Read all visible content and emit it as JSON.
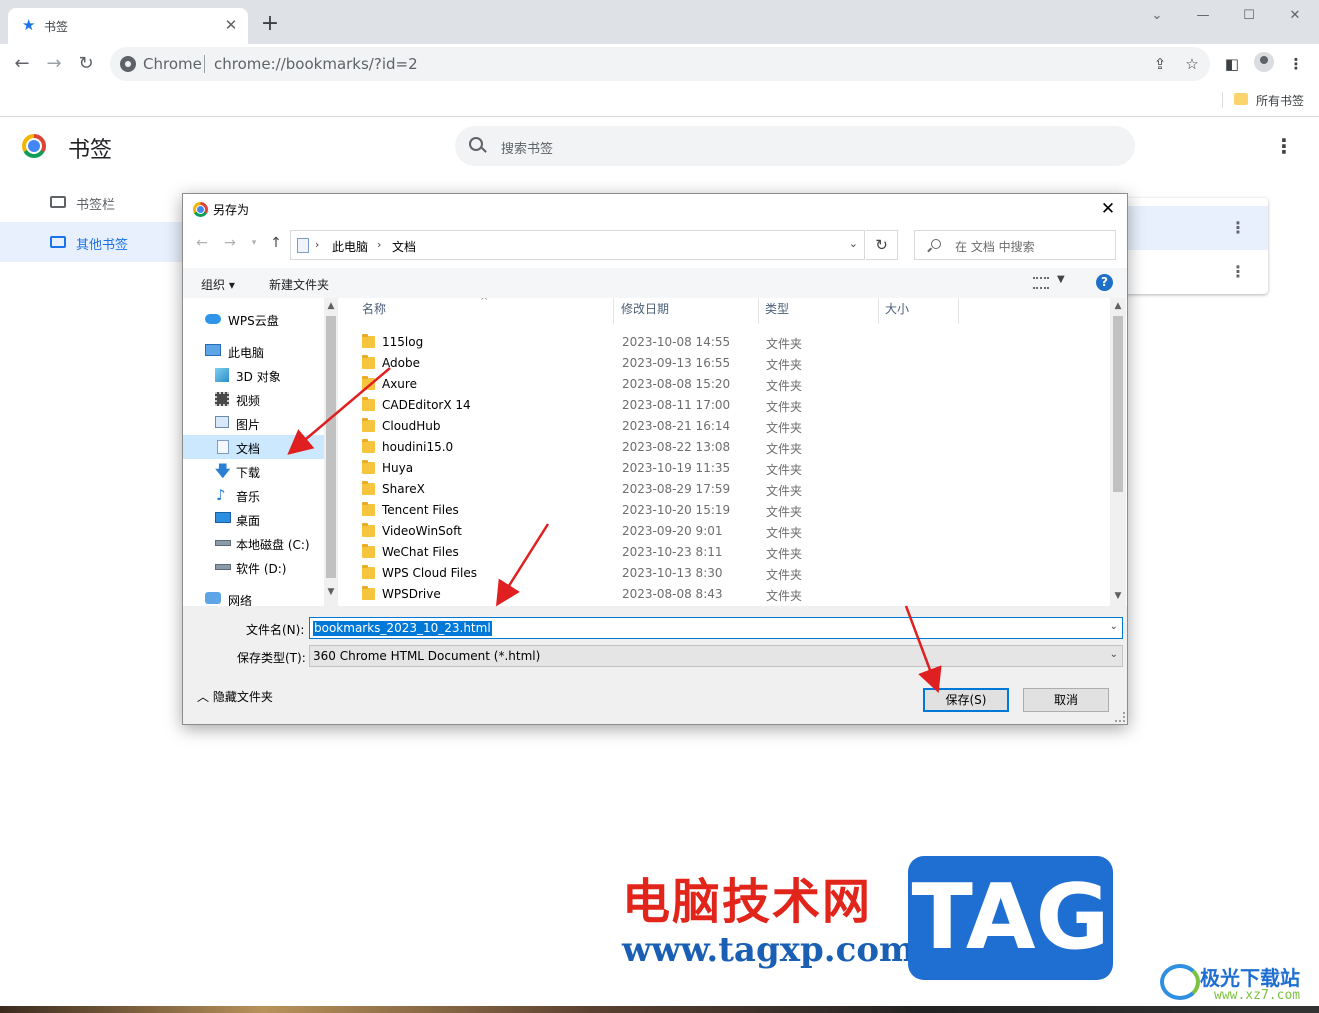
{
  "browser": {
    "tab_title": "书签",
    "omnibox_site": "Chrome",
    "omnibox_url": "chrome://bookmarks/?id=2",
    "bookmarks_bar_item": "所有书签"
  },
  "page": {
    "title": "书签",
    "search_placeholder": "搜索书签",
    "nav": [
      {
        "label": "书签栏",
        "active": false
      },
      {
        "label": "其他书签",
        "active": true
      }
    ]
  },
  "dialog": {
    "title": "另存为",
    "breadcrumb": [
      "此电脑",
      "文档"
    ],
    "search_placeholder": "在 文档 中搜索",
    "toolbar": {
      "organize": "组织 ▾",
      "new_folder": "新建文件夹"
    },
    "tree": [
      {
        "label": "WPS云盘",
        "icon": "cloud-icon"
      },
      {
        "label": "此电脑",
        "icon": "computer-icon"
      },
      {
        "label": "3D 对象",
        "icon": "cube-icon"
      },
      {
        "label": "视频",
        "icon": "video-icon"
      },
      {
        "label": "图片",
        "icon": "picture-icon"
      },
      {
        "label": "文档",
        "icon": "document-icon",
        "selected": true
      },
      {
        "label": "下载",
        "icon": "download-icon"
      },
      {
        "label": "音乐",
        "icon": "music-icon"
      },
      {
        "label": "桌面",
        "icon": "desktop-icon"
      },
      {
        "label": "本地磁盘 (C:)",
        "icon": "drive-icon"
      },
      {
        "label": "软件 (D:)",
        "icon": "drive-icon"
      },
      {
        "label": "网络",
        "icon": "network-icon"
      }
    ],
    "columns": {
      "name": "名称",
      "date": "修改日期",
      "type": "类型",
      "size": "大小"
    },
    "files": [
      {
        "name": "115log",
        "date": "2023-10-08 14:55",
        "type": "文件夹"
      },
      {
        "name": "Adobe",
        "date": "2023-09-13 16:55",
        "type": "文件夹"
      },
      {
        "name": "Axure",
        "date": "2023-08-08 15:20",
        "type": "文件夹"
      },
      {
        "name": "CADEditorX 14",
        "date": "2023-08-11 17:00",
        "type": "文件夹"
      },
      {
        "name": "CloudHub",
        "date": "2023-08-21 16:14",
        "type": "文件夹"
      },
      {
        "name": "houdini15.0",
        "date": "2023-08-22 13:08",
        "type": "文件夹"
      },
      {
        "name": "Huya",
        "date": "2023-10-19 11:35",
        "type": "文件夹"
      },
      {
        "name": "ShareX",
        "date": "2023-08-29 17:59",
        "type": "文件夹"
      },
      {
        "name": "Tencent Files",
        "date": "2023-10-20 15:19",
        "type": "文件夹"
      },
      {
        "name": "VideoWinSoft",
        "date": "2023-09-20 9:01",
        "type": "文件夹"
      },
      {
        "name": "WeChat Files",
        "date": "2023-10-23 8:11",
        "type": "文件夹"
      },
      {
        "name": "WPS Cloud Files",
        "date": "2023-10-13 8:30",
        "type": "文件夹"
      },
      {
        "name": "WPSDrive",
        "date": "2023-08-08 8:43",
        "type": "文件夹"
      }
    ],
    "filename_label": "文件名(N):",
    "filename_value": "bookmarks_2023_10_23.html",
    "filetype_label": "保存类型(T):",
    "filetype_value": "360 Chrome HTML Document (*.html)",
    "hide_folders": "隐藏文件夹",
    "save_button": "保存(S)",
    "cancel_button": "取消"
  },
  "watermark": {
    "cn": "电脑技术网",
    "url": "www.tagxp.com",
    "tag": "TAG",
    "site_name": "极光下载站",
    "site_url": "www.xz7.com"
  },
  "colors": {
    "accent": "#1a73e8",
    "selection": "#0078d7",
    "arrow": "#e02020"
  }
}
